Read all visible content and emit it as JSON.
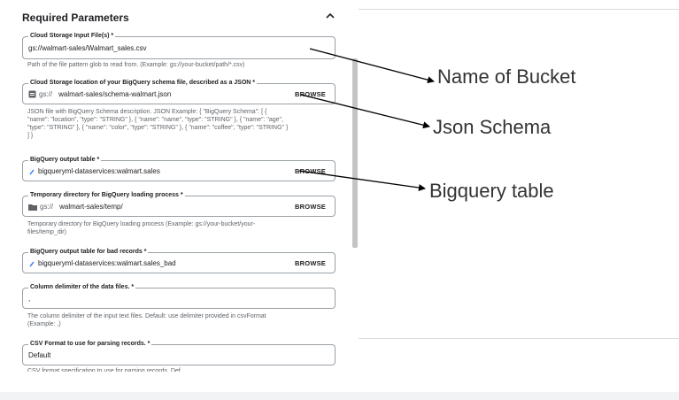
{
  "section": {
    "title": "Required Parameters"
  },
  "fields": {
    "input_file": {
      "label": "Cloud Storage Input File(s) *",
      "value": "gs://walmart-sales/Walmart_sales.csv",
      "help": "Path of the file pattern glob to read from. (Example: gs://your-bucket/path/*.csv)"
    },
    "schema": {
      "label": "Cloud Storage location of your BigQuery schema file, described as a JSON *",
      "prefix": "gs://",
      "value": "walmart-sales/schema-walmart.json",
      "browse": "BROWSE",
      "help_line1": "JSON file with BigQuery Schema description. JSON Example: { \"BigQuery Schema\": [ {",
      "help_line2": "\"name\": \"location\", \"type\": \"STRING\" }, { \"name\": \"name\", \"type\": \"STRING\" }, { \"name\": \"age\",",
      "help_line3": "\"type\": \"STRING\" }, { \"name\": \"color\", \"type\": \"STRING\" }, { \"name\": \"coffee\", \"type\": \"STRING\" }",
      "help_line4": "] }"
    },
    "output_table": {
      "label": "BigQuery output table *",
      "value": "bigqueryml-dataservices:walmart.sales",
      "browse": "BROWSE"
    },
    "temp_dir": {
      "label": "Temporary directory for BigQuery loading process *",
      "prefix": "gs://",
      "value": "walmart-sales/temp/",
      "browse": "BROWSE",
      "help_line1": "Temporary directory for BigQuery loading process (Example: gs://your-bucket/your-",
      "help_line2": "files/temp_dir)"
    },
    "bad_records": {
      "label": "BigQuery output table for bad records *",
      "value": "bigqueryml-dataservices:walmart.sales_bad",
      "browse": "BROWSE"
    },
    "delimiter": {
      "label": "Column delimiter of the data files. *",
      "value": ",",
      "help_line1": "The column delimiter of the input text files. Default: use delimiter provided in csvFormat",
      "help_line2": "(Example: ,)"
    },
    "csv_format": {
      "label": "CSV Format to use for parsing records. *",
      "value": "Default",
      "help": "CSV format specification to use for parsing records. Def"
    }
  },
  "annotations": {
    "bucket": "Name of Bucket",
    "json_schema": "Json Schema",
    "bq_table": "Bigquery table"
  },
  "icons": {
    "chevron": "chevron-up-icon",
    "file": "file-icon",
    "folder": "folder-icon",
    "table": "table-icon"
  },
  "colors": {
    "border": "#9aa0a6",
    "text": "#202124",
    "help": "#5f6368",
    "arrow": "#000000"
  }
}
